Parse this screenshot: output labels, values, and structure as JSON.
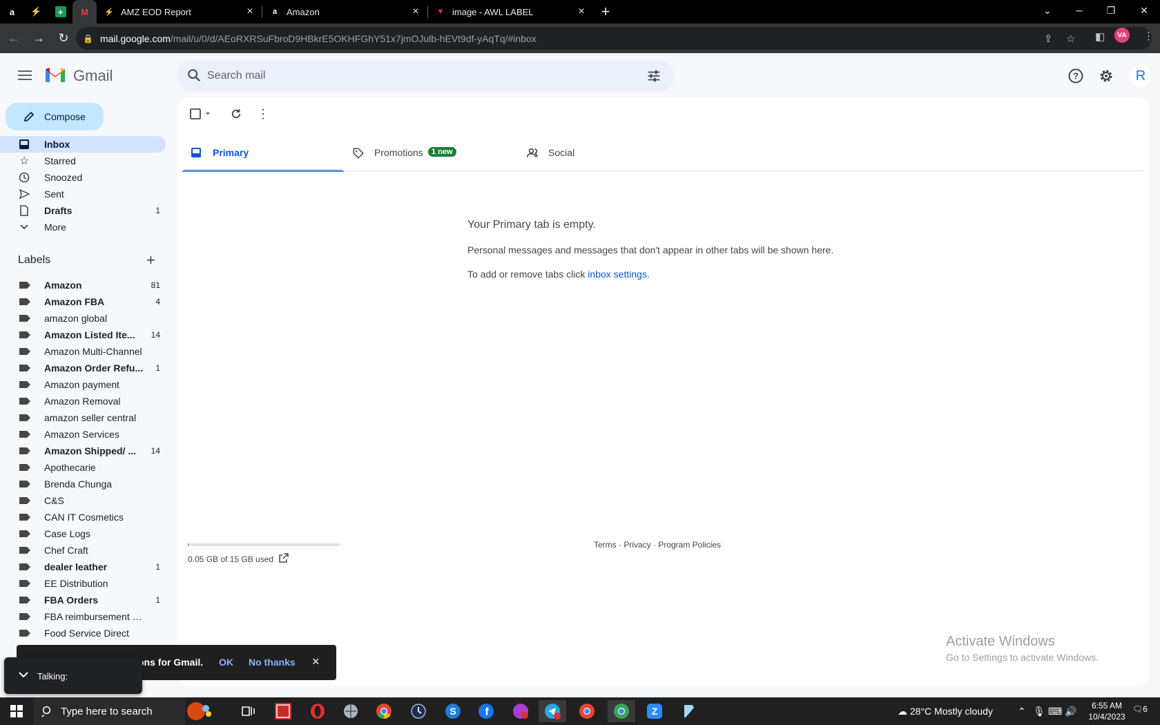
{
  "browser": {
    "pinned_tabs": [
      "a",
      "⚡",
      "+",
      "M"
    ],
    "tabs": [
      {
        "title": "AMZ EOD Report",
        "close": "×"
      },
      {
        "title": "Amazon",
        "close": "×"
      },
      {
        "title": "image - AWL LABEL",
        "close": "×"
      }
    ],
    "new_tab": "+",
    "url_host": "mail.google.com",
    "url_path": "/mail/u/0/d/AEoRXRSuFbroD9HBkrE5OKHFGhY51x7jmOJulb-hEVt9df-yAqTq/#inbox",
    "profile_initials": "VA"
  },
  "gmail": {
    "brand": "Gmail",
    "search_placeholder": "Search mail",
    "avatar_initial": "R"
  },
  "sidebar": {
    "compose_label": "Compose",
    "nav": [
      {
        "label": "Inbox",
        "count": ""
      },
      {
        "label": "Starred",
        "count": ""
      },
      {
        "label": "Snoozed",
        "count": ""
      },
      {
        "label": "Sent",
        "count": ""
      },
      {
        "label": "Drafts",
        "count": "1"
      },
      {
        "label": "More",
        "count": ""
      }
    ],
    "labels_heading": "Labels",
    "labels": [
      {
        "name": "Amazon",
        "count": "81"
      },
      {
        "name": "Amazon FBA",
        "count": "4"
      },
      {
        "name": "amazon global",
        "count": ""
      },
      {
        "name": "Amazon Listed Ite...",
        "count": "14"
      },
      {
        "name": "Amazon Multi-Channel",
        "count": ""
      },
      {
        "name": "Amazon Order Refu...",
        "count": "1"
      },
      {
        "name": "Amazon payment",
        "count": ""
      },
      {
        "name": "Amazon Removal",
        "count": ""
      },
      {
        "name": "amazon seller central",
        "count": ""
      },
      {
        "name": "Amazon Services",
        "count": ""
      },
      {
        "name": "Amazon Shipped/ ...",
        "count": "14"
      },
      {
        "name": "Apothecarie",
        "count": ""
      },
      {
        "name": "Brenda Chunga",
        "count": ""
      },
      {
        "name": "C&S",
        "count": ""
      },
      {
        "name": "CAN IT Cosmetics",
        "count": ""
      },
      {
        "name": "Case Logs",
        "count": ""
      },
      {
        "name": "Chef Craft",
        "count": ""
      },
      {
        "name": "dealer leather",
        "count": "1"
      },
      {
        "name": "EE Distribution",
        "count": ""
      },
      {
        "name": "FBA Orders",
        "count": "1"
      },
      {
        "name": "FBA reimbursement noti...",
        "count": ""
      },
      {
        "name": "Food Service Direct",
        "count": ""
      }
    ]
  },
  "main": {
    "tabs": [
      {
        "label": "Primary"
      },
      {
        "label": "Promotions",
        "badge": "1 new"
      },
      {
        "label": "Social"
      }
    ],
    "empty_title": "Your Primary tab is empty.",
    "empty_text": "Personal messages and messages that don't appear in other tabs will be shown here.",
    "settings_prefix": "To add or remove tabs click ",
    "settings_link": "inbox settings",
    "settings_suffix": ".",
    "storage_text": "0.05 GB of 15 GB used",
    "storage_fraction": 0.0033,
    "footer": "Terms · Privacy · Program Policies",
    "activate_title": "Activate Windows",
    "activate_sub": "Go to Settings to activate Windows."
  },
  "snackbar": {
    "message": "ons for Gmail.",
    "ok": "OK",
    "no_thanks": "No thanks",
    "close": "×"
  },
  "talking": {
    "label": "Talking:"
  },
  "taskbar": {
    "search_placeholder": "Type here to search",
    "weather": "28°C  Mostly cloudy",
    "time": "6:55 AM",
    "date": "10/4/2023",
    "notif_count": "6"
  }
}
